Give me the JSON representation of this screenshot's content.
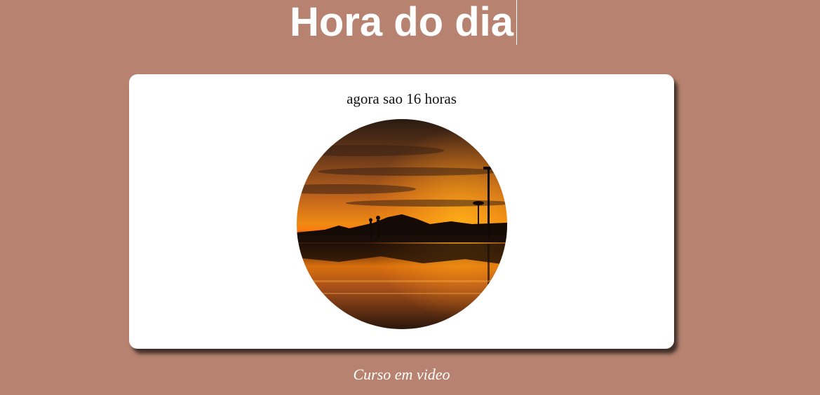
{
  "page": {
    "title": "Hora do dia",
    "background_color": "#b78370"
  },
  "card": {
    "message": "agora sao 16 horas",
    "image": {
      "subject": "sunset-beach-photo",
      "shape": "circle"
    }
  },
  "footer": {
    "credit": "Curso em video"
  }
}
